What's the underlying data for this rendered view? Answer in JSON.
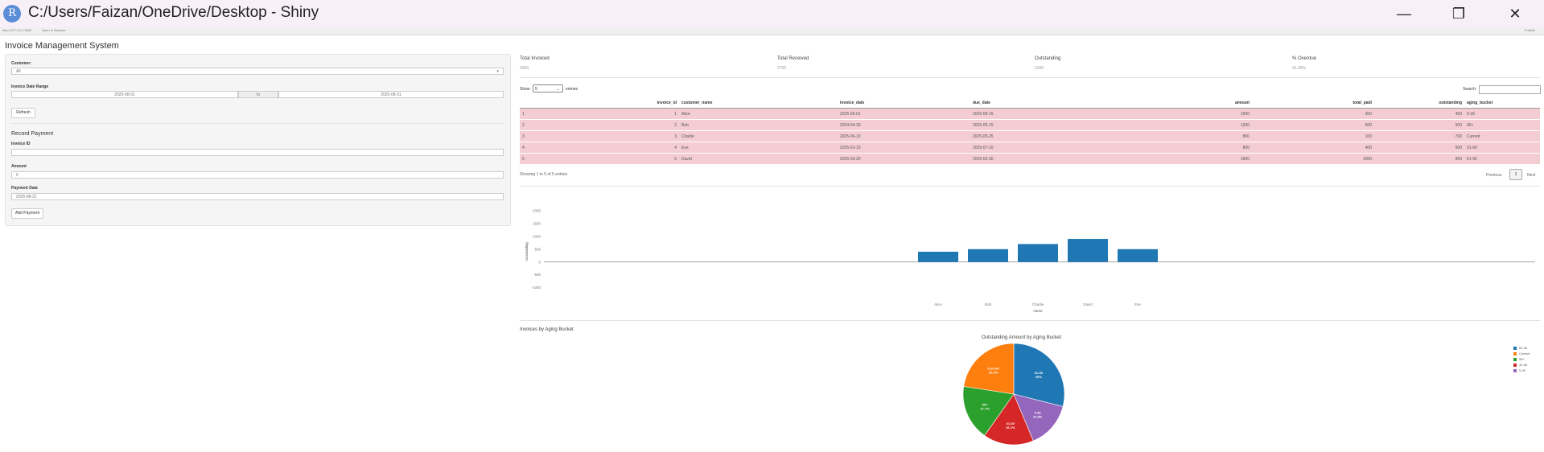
{
  "window": {
    "icon_letter": "R",
    "title": "C:/Users/Faizan/OneDrive/Desktop - Shiny",
    "minimize": "—",
    "maximize": "❐",
    "close": "✕"
  },
  "toolbar": {
    "url": "http://127.0.0.1:5987",
    "open_in_browser": "Open in Browser",
    "publish": "Publish"
  },
  "app": {
    "title": "Invoice Management System"
  },
  "sidebar": {
    "customer_label": "Customer:",
    "customer_value": "All",
    "date_range_label": "Invoice Date Range",
    "date_from": "2025-08-01",
    "date_sep": "to",
    "date_to": "2025-08-31",
    "refresh_button": "Refresh",
    "record_payment_title": "Record Payment",
    "invoice_id_label": "Invoice ID",
    "invoice_id_value": "",
    "amount_label": "Amount",
    "amount_value": "0",
    "payment_date_label": "Payment Date",
    "payment_date_value": "2025-08-31",
    "add_payment_button": "Add Payment"
  },
  "summary": [
    {
      "label": "Total Invoiced",
      "value": "5300"
    },
    {
      "label": "Total Received",
      "value": "2700"
    },
    {
      "label": "Outstanding",
      "value": "3100"
    },
    {
      "label": "% Overdue",
      "value": "41.26%"
    }
  ],
  "table": {
    "show_label": "Show",
    "page_length": "5",
    "entries_label": "entries",
    "search_label": "Search:",
    "columns": [
      "invoice_id",
      "customer_name",
      "invoice_date",
      "due_date",
      "amount",
      "total_paid",
      "outstanding",
      "aging_bucket"
    ],
    "rows": [
      [
        "1",
        "1",
        "Alice",
        "2025-05-01",
        "2025-05-15",
        "1000",
        "300",
        "400",
        "0-30"
      ],
      [
        "2",
        "2",
        "Bob",
        "2024-04-30",
        "2025-05-15",
        "1200",
        "600",
        "500",
        "90+"
      ],
      [
        "3",
        "3",
        "Charlie",
        "2025-06-10",
        "2025-05-25",
        "800",
        "100",
        "700",
        "Current"
      ],
      [
        "4",
        "4",
        "Eve",
        "2025-01-10",
        "2025-07-10",
        "800",
        "400",
        "500",
        "31-60"
      ],
      [
        "5",
        "5",
        "David",
        "2025-03-20",
        "2025-03-30",
        "1600",
        "1000",
        "900",
        "61-90"
      ]
    ],
    "info": "Showing 1 to 5 of 5 entries",
    "previous": "Previous",
    "page": "1",
    "next": "Next"
  },
  "pie_section_title": "Invoices by Aging Bucket",
  "chart_data": [
    {
      "type": "bar",
      "categories": [
        "Alice",
        "Bob",
        "Charlie",
        "David",
        "Eve"
      ],
      "values": [
        400,
        500,
        700,
        900,
        500
      ],
      "xlabel": "name",
      "ylabel": "outstanding",
      "ylim": [
        -1200,
        2000
      ],
      "ticks": [
        2000,
        1500,
        1000,
        500,
        0,
        -500,
        -1000
      ],
      "bar_color": "#1f77b4",
      "grid": false
    },
    {
      "type": "pie",
      "title": "Outstanding Amount by Aging Bucket",
      "labels": [
        "61-90",
        "0-30",
        "31-60",
        "90+",
        "Current"
      ],
      "values": [
        29,
        14.8,
        16.1,
        17.7,
        22.6
      ],
      "display_values": [
        "29%",
        "14.8%",
        "16.1%",
        "17.7%",
        "22.6%"
      ],
      "colors": [
        "#1f77b4",
        "#9467bd",
        "#d62728",
        "#2ca02c",
        "#ff7f0e"
      ],
      "legend": [
        {
          "label": "61-90",
          "color": "#1f77b4"
        },
        {
          "label": "Current",
          "color": "#ff7f0e"
        },
        {
          "label": "90+",
          "color": "#2ca02c"
        },
        {
          "label": "31-60",
          "color": "#d62728"
        },
        {
          "label": "0-30",
          "color": "#9467bd"
        }
      ],
      "legend_position": "top-right"
    }
  ]
}
